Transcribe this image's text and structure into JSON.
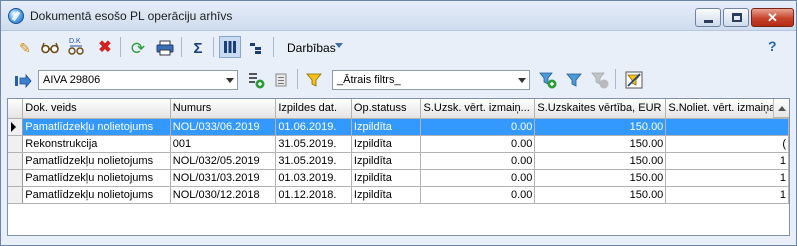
{
  "window": {
    "title": "Dokumentā esošo PL operāciju arhīvs",
    "close_glyph": "✕"
  },
  "toolbar": {
    "actions_label": "Darbības",
    "help_label": "?",
    "icons": [
      "pencil-icon",
      "glasses-icon",
      "dk-icon",
      "delete-icon",
      "refresh-icon",
      "print-icon",
      "sigma-icon",
      "columns-icon",
      "tree-icon"
    ]
  },
  "filter_bar": {
    "asset_value": "AIVA 29806",
    "quick_filter_value": "_Ātrais filtrs_"
  },
  "grid": {
    "columns": [
      "Dok. veids",
      "Numurs",
      "Izpildes dat.",
      "Op.statuss",
      "S.Uzsk. vērt. izmaiņ...",
      "S.Uzskaites vērtība, EUR",
      "S.Noliet. vērt. izmaiņa"
    ],
    "rows": [
      [
        "Pamatlīdzekļu nolietojums",
        "NOL/033/06.2019",
        "01.06.2019.",
        "Izpildīta",
        "0.00",
        "150.00",
        ""
      ],
      [
        "Rekonstrukcija",
        "001",
        "31.05.2019.",
        "Izpildīta",
        "0.00",
        "150.00",
        "("
      ],
      [
        "Pamatlīdzekļu nolietojums",
        "NOL/032/05.2019",
        "31.05.2019.",
        "Izpildīta",
        "0.00",
        "150.00",
        "1"
      ],
      [
        "Pamatlīdzekļu nolietojums",
        "NOL/031/03.2019",
        "01.03.2019.",
        "Izpildīta",
        "0.00",
        "150.00",
        "1"
      ],
      [
        "Pamatlīdzekļu nolietojums",
        "NOL/030/12.2018",
        "01.12.2018.",
        "Izpildīta",
        "0.00",
        "150.00",
        "1"
      ]
    ],
    "selected_row": 0
  },
  "colors": {
    "selection": "#3399ff",
    "accent": "#2563b4"
  }
}
